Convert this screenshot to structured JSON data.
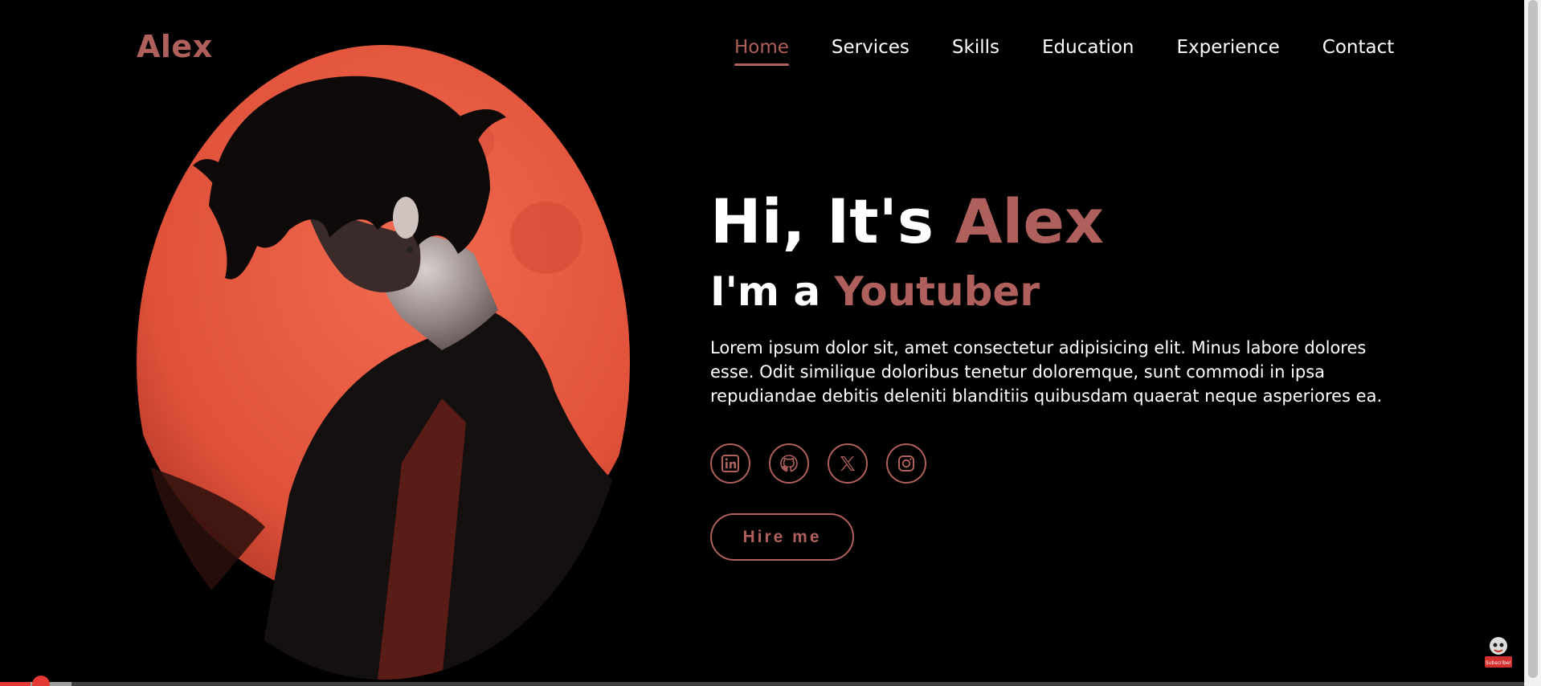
{
  "header": {
    "logo": "Alex",
    "nav": [
      {
        "label": "Home",
        "active": true
      },
      {
        "label": "Services"
      },
      {
        "label": "Skills"
      },
      {
        "label": "Education"
      },
      {
        "label": "Experience"
      },
      {
        "label": "Contact"
      }
    ]
  },
  "hero": {
    "greeting_prefix": "Hi, It's ",
    "greeting_name": "Alex",
    "role_prefix": "I'm a ",
    "role": "Youtuber",
    "description": "Lorem ipsum dolor sit, amet consectetur adipisicing elit. Minus labore dolores esse. Odit similique doloribus tenetur doloremque, sunt commodi in ipsa repudiandae debitis deleniti blanditiis quibusdam quaerat neque asperiores ea.",
    "socials": [
      "linkedin-icon",
      "github-icon",
      "x-icon",
      "instagram-icon"
    ],
    "hire_label": "Hire me"
  },
  "video": {
    "progress_fraction": 0.02,
    "buffered_fraction": 0.047
  },
  "colors": {
    "accent": "#b0605c",
    "background": "#000000",
    "moon": "#e8543d",
    "progress": "#e53935"
  },
  "overlay": {
    "subscribe_label": "Subscribe!"
  }
}
